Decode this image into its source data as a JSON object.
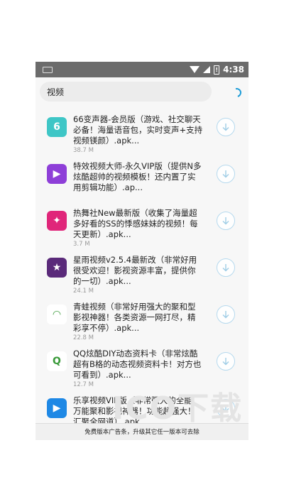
{
  "status_bar": {
    "time": "4:38",
    "battery_glyph": "!"
  },
  "search": {
    "query": "视频"
  },
  "list_items": [
    {
      "title": "66变声器-会员版（游戏、社交聊天\n必备！海量语音包，实时变声+支持\n视频镁颜）.apk...",
      "size": "38.7 M",
      "icon": "video-camera-icon",
      "icon_glyph": "6",
      "icon_color": "#3ec6c6"
    },
    {
      "title": "特效视频大师-永久VIP版（提供N多\n炫酷超帅的视频模板！还内置了实\n用剪辑功能）.ap...",
      "size": "",
      "icon": "film-icon",
      "icon_glyph": "▶",
      "icon_color": "#8e3fd8"
    },
    {
      "title": "热舞社New最新版（收集了海量超\n多好看的SS的悸感妹妹的视频！每\n天更新）.apk...",
      "size": "3.7 M",
      "icon": "dancer-icon",
      "icon_glyph": "✦",
      "icon_color": "#e0267a"
    },
    {
      "title": "星雨视频v2.5.4最新改（非常好用\n很受欢迎！影视资源丰富，提供你\n的一切）.apk...",
      "size": "24.1 M",
      "icon": "star-icon",
      "icon_glyph": "★",
      "icon_color": "#5a2a7a"
    },
    {
      "title": "青蛙视频（非常好用强大的聚和型\n影视神器！各类资源一网打尽，精\n彩享不停）.apk...",
      "size": "22.8 M",
      "icon": "android-icon",
      "icon_glyph": "◠",
      "icon_color": "#ffffff"
    },
    {
      "title": "QQ炫酷DIY动态资料卡（非常炫酷\n超有B格的动态视频资料卡！对方也\n可看到）.apk...",
      "size": "12.7 M",
      "icon": "qq-penguin-icon",
      "icon_glyph": "Q",
      "icon_color": "#ffffff"
    },
    {
      "title": "乐享视频VIP版（非常强大的全能、\n万能聚和影视神器！功能超强大！\n汇聚全网道）.apk...",
      "size": "",
      "icon": "play-icon",
      "icon_glyph": "▶",
      "icon_color": "#1e88e5"
    }
  ],
  "watermark": "ICO下载",
  "ad_bar": {
    "text": "免费版本广告条，升级其它任一版本可去除"
  },
  "colors": {
    "accent": "#1a9bd7",
    "statusbar": "#6b6b6b"
  }
}
